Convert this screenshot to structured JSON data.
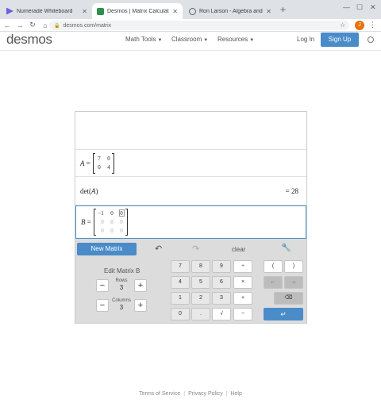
{
  "browser": {
    "tabs": [
      {
        "label": "Numerade Whiteboard",
        "icon": "numerade-icon",
        "active": false
      },
      {
        "label": "Desmos | Matrix Calculator",
        "icon": "desmos-icon",
        "active": true
      },
      {
        "label": "Ron Larson - Algebra and Trigo...",
        "icon": "web-icon",
        "active": false
      }
    ],
    "url": "desmos.com/matrix",
    "profile_initial": "J"
  },
  "header": {
    "logo": "desmos",
    "nav": [
      "Math Tools",
      "Classroom",
      "Resources"
    ],
    "login": "Log In",
    "signup": "Sign Up"
  },
  "calculator": {
    "matrix_a": {
      "name": "A",
      "rows": [
        [
          "7",
          "0"
        ],
        [
          "0",
          "4"
        ]
      ]
    },
    "determinant": {
      "expr_prefix": "det(",
      "expr_var": "A",
      "expr_suffix": ")",
      "result": "= 28"
    },
    "matrix_b": {
      "name": "B",
      "rows": [
        [
          "−1",
          "0",
          "0"
        ],
        [
          "0",
          "0",
          "0"
        ],
        [
          "0",
          "0",
          "0"
        ]
      ]
    },
    "toolbar": {
      "new_matrix": "New Matrix",
      "clear": "clear"
    },
    "edit": {
      "title": "Edit Matrix B",
      "rows_label": "Rows",
      "rows_value": "3",
      "columns_label": "Columns",
      "columns_value": "3"
    },
    "keys": {
      "r1": [
        "7",
        "8",
        "9",
        "÷"
      ],
      "r2": [
        "4",
        "5",
        "6",
        "×"
      ],
      "r3": [
        "1",
        "2",
        "3",
        "+"
      ],
      "r4": [
        "0",
        ".",
        "√",
        "−"
      ],
      "parens": [
        "(",
        ")"
      ],
      "arrows": [
        "←",
        "→"
      ]
    }
  },
  "footer": {
    "links": [
      "Terms of Service",
      "Privacy Policy",
      "Help"
    ]
  }
}
